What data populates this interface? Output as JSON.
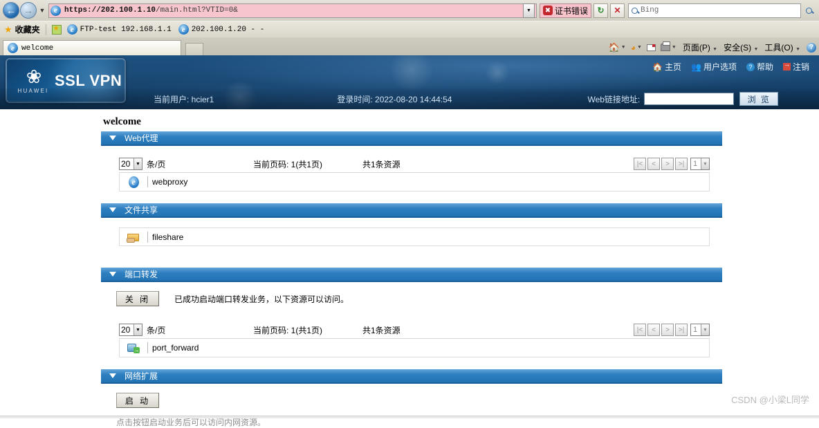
{
  "browser": {
    "back_icon": "back-arrow-icon",
    "forward_icon": "forward-arrow-icon",
    "history_dropdown": "▾",
    "url_prefix": "https://202.100.1.10",
    "url_suffix": "/main.html?VTID=0&",
    "url_full": "https://202.100.1.10/main.html?VTID=0&",
    "cert_error": "证书错误",
    "refresh_label": "↻",
    "stop_label": "✕",
    "search_placeholder": "Bing",
    "favorites_label": "收藏夹",
    "favorites": [
      {
        "label": "FTP-test 192.168.1.1"
      },
      {
        "label": "202.100.1.20 - -"
      }
    ],
    "tab_title": "welcome",
    "commandbar": {
      "page_menu": "页面(P)",
      "safety_menu": "安全(S)",
      "tools_menu": "工具(O)",
      "help_label": "?"
    }
  },
  "vpn": {
    "brand": "HUAWEI",
    "product": "SSL VPN",
    "topnav": [
      {
        "label": "主页",
        "icon": "home-icon"
      },
      {
        "label": "用户选项",
        "icon": "users-icon"
      },
      {
        "label": "帮助",
        "icon": "help-icon"
      },
      {
        "label": "注销",
        "icon": "logout-icon"
      }
    ],
    "current_user_label": "当前用户: hcier1",
    "login_time_label": "登录时间: 2022-08-20  14:44:54",
    "weblink_label": "Web链接地址:",
    "weblink_value": "",
    "browse_button": "浏 览",
    "page_title": "welcome"
  },
  "sections": {
    "webproxy": {
      "title": "Web代理",
      "per_page": "20",
      "per_page_unit": "条/页",
      "current_page": "当前页码: 1(共1页)",
      "total": "共1条资源",
      "page_select": "1",
      "nav": [
        "|<",
        "<",
        ">",
        ">|"
      ],
      "resource": "webproxy",
      "resource_icon": "ie-browser-icon"
    },
    "fileshare": {
      "title": "文件共享",
      "resource": "fileshare",
      "resource_icon": "folder-share-icon"
    },
    "portforward": {
      "title": "端口转发",
      "button": "关 闭",
      "message": "已成功启动端口转发业务，以下资源可以访问。",
      "per_page": "20",
      "per_page_unit": "条/页",
      "current_page": "当前页码: 1(共1页)",
      "total": "共1条资源",
      "page_select": "1",
      "nav": [
        "|<",
        "<",
        ">",
        ">|"
      ],
      "resource": "port_forward",
      "resource_icon": "port-forward-cube-icon"
    },
    "networkextension": {
      "title": "网络扩展",
      "button": "启 动",
      "hint": "点击按钮启动业务后可以访问内网资源。"
    }
  },
  "watermark": "CSDN @小梁L同学",
  "colors": {
    "accent": "#2273b4",
    "header_dark": "#123a60",
    "address_warn": "#f7c6cd"
  }
}
